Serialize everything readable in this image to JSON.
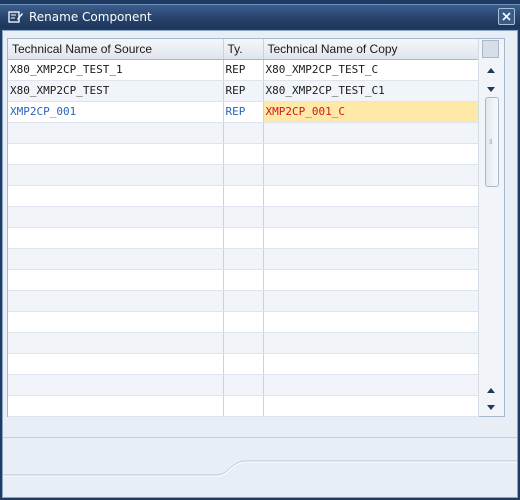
{
  "window": {
    "title": "Rename Component"
  },
  "icons": {
    "title": "rename-icon",
    "close": "close-icon",
    "scroll_up": "arrow-up-icon",
    "scroll_down": "arrow-down-icon"
  },
  "colors": {
    "titlebar": "#2a4872",
    "selected_source_text": "#2c64b8",
    "selected_copy_bg": "#ffe9a8",
    "selected_copy_text": "#d01818"
  },
  "table": {
    "headers": {
      "source": "Technical Name of Source",
      "type": "Ty.",
      "copy": "Technical Name of Copy"
    },
    "rows": [
      {
        "source": "X80_XMP2CP_TEST_1",
        "type": "REP",
        "copy": "X80_XMP2CP_TEST_C"
      },
      {
        "source": "X80_XMP2CP_TEST",
        "type": "REP",
        "copy": "X80_XMP2CP_TEST_C1"
      },
      {
        "source": "XMP2CP_001",
        "type": "REP",
        "copy": "XMP2CP_001_C",
        "selected": true
      }
    ],
    "empty_row_count": 14
  }
}
